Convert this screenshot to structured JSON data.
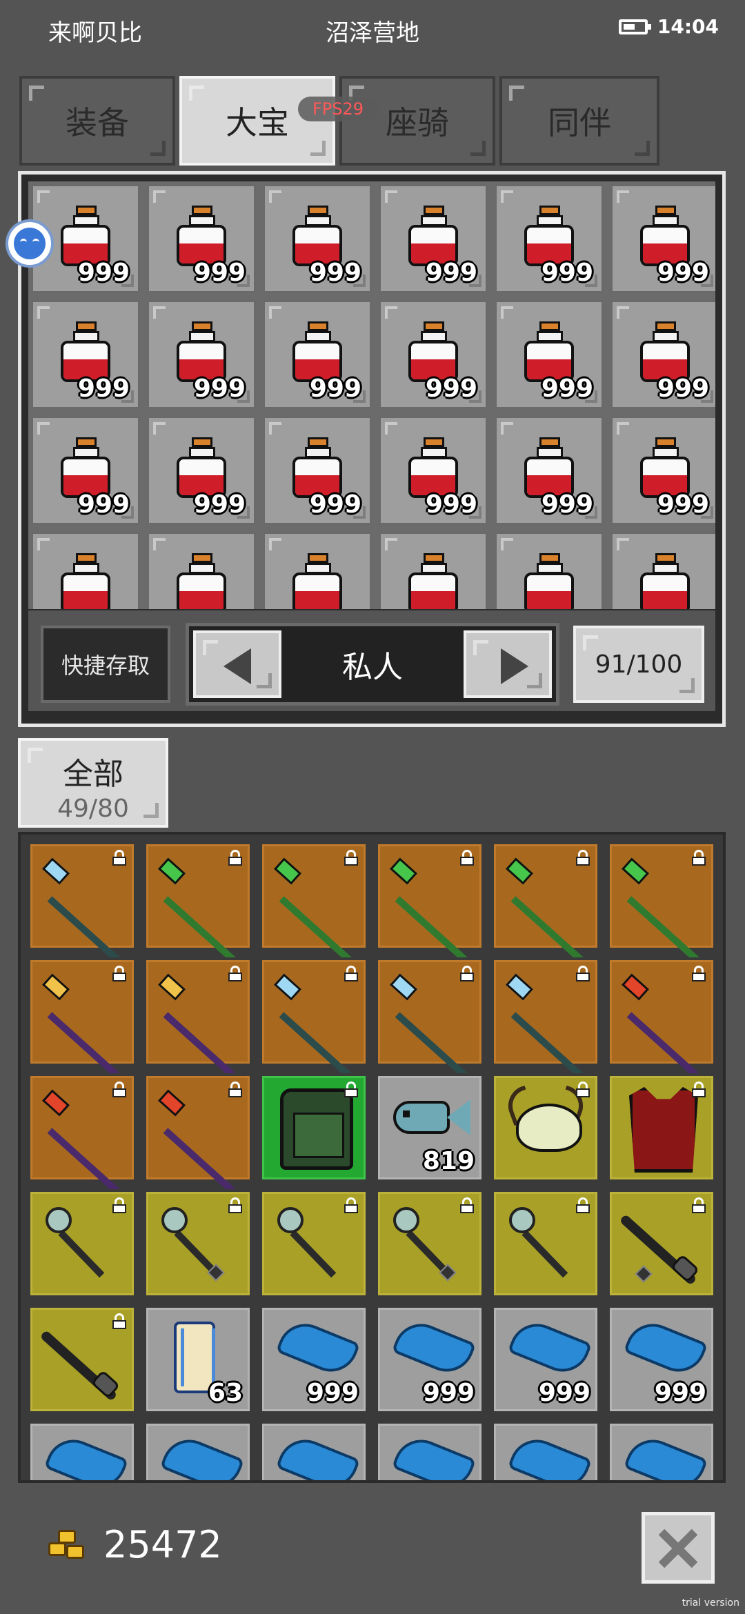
{
  "status_bar": {
    "left_text": "来啊贝比",
    "center_text": "沼泽营地",
    "time": "14:04"
  },
  "tabs": [
    {
      "label": "装备",
      "active": false
    },
    {
      "label": "大宝",
      "active": true
    },
    {
      "label": "座骑",
      "active": false
    },
    {
      "label": "同伴",
      "active": false
    }
  ],
  "fps_badge": "FPS29",
  "storage": {
    "slots": [
      {
        "item": "red-potion",
        "qty": "999"
      },
      {
        "item": "red-potion",
        "qty": "999"
      },
      {
        "item": "red-potion",
        "qty": "999"
      },
      {
        "item": "red-potion",
        "qty": "999"
      },
      {
        "item": "red-potion",
        "qty": "999"
      },
      {
        "item": "red-potion",
        "qty": "999"
      },
      {
        "item": "red-potion",
        "qty": "999"
      },
      {
        "item": "red-potion",
        "qty": "999"
      },
      {
        "item": "red-potion",
        "qty": "999"
      },
      {
        "item": "red-potion",
        "qty": "999"
      },
      {
        "item": "red-potion",
        "qty": "999"
      },
      {
        "item": "red-potion",
        "qty": "999"
      },
      {
        "item": "red-potion",
        "qty": "999"
      },
      {
        "item": "red-potion",
        "qty": "999"
      },
      {
        "item": "red-potion",
        "qty": "999"
      },
      {
        "item": "red-potion",
        "qty": "999"
      },
      {
        "item": "red-potion",
        "qty": "999"
      },
      {
        "item": "red-potion",
        "qty": "999"
      },
      {
        "item": "red-potion",
        "qty": ""
      },
      {
        "item": "red-potion",
        "qty": ""
      },
      {
        "item": "red-potion",
        "qty": ""
      },
      {
        "item": "red-potion",
        "qty": ""
      },
      {
        "item": "red-potion",
        "qty": ""
      },
      {
        "item": "red-potion",
        "qty": ""
      }
    ],
    "quick_access_label": "快捷存取",
    "page_label": "私人",
    "capacity": "91/100"
  },
  "bag": {
    "category_label": "全部",
    "category_count": "49/80",
    "slots": [
      {
        "item": "ice-staff",
        "bg": "brown",
        "locked": true,
        "qty": ""
      },
      {
        "item": "green-staff",
        "bg": "brown",
        "locked": true,
        "qty": ""
      },
      {
        "item": "green-staff",
        "bg": "brown",
        "locked": true,
        "qty": ""
      },
      {
        "item": "green-staff",
        "bg": "brown",
        "locked": true,
        "qty": ""
      },
      {
        "item": "green-staff",
        "bg": "brown",
        "locked": true,
        "qty": ""
      },
      {
        "item": "green-staff",
        "bg": "brown",
        "locked": true,
        "qty": ""
      },
      {
        "item": "gold-staff",
        "bg": "brown",
        "locked": true,
        "qty": ""
      },
      {
        "item": "gold-staff",
        "bg": "brown",
        "locked": true,
        "qty": ""
      },
      {
        "item": "ice-staff",
        "bg": "brown",
        "locked": true,
        "qty": ""
      },
      {
        "item": "ice-staff",
        "bg": "brown",
        "locked": true,
        "qty": ""
      },
      {
        "item": "ice-staff",
        "bg": "brown",
        "locked": true,
        "qty": ""
      },
      {
        "item": "fire-staff",
        "bg": "brown",
        "locked": true,
        "qty": ""
      },
      {
        "item": "fire-staff",
        "bg": "brown",
        "locked": true,
        "qty": ""
      },
      {
        "item": "fire-staff",
        "bg": "brown",
        "locked": true,
        "qty": ""
      },
      {
        "item": "backpack",
        "bg": "green",
        "locked": true,
        "qty": ""
      },
      {
        "item": "fish",
        "bg": "gray",
        "locked": false,
        "qty": "819"
      },
      {
        "item": "horned-helmet",
        "bg": "olive",
        "locked": true,
        "qty": ""
      },
      {
        "item": "red-armor",
        "bg": "olive",
        "locked": true,
        "qty": ""
      },
      {
        "item": "orb-wand",
        "bg": "olive",
        "locked": true,
        "qty": ""
      },
      {
        "item": "orb-wand-gem",
        "bg": "olive",
        "locked": true,
        "qty": ""
      },
      {
        "item": "orb-wand",
        "bg": "olive",
        "locked": true,
        "qty": ""
      },
      {
        "item": "orb-wand-gem",
        "bg": "olive",
        "locked": true,
        "qty": ""
      },
      {
        "item": "orb-wand",
        "bg": "olive",
        "locked": true,
        "qty": ""
      },
      {
        "item": "dark-club-gem",
        "bg": "olive",
        "locked": true,
        "qty": ""
      },
      {
        "item": "dark-club",
        "bg": "olive",
        "locked": true,
        "qty": ""
      },
      {
        "item": "scroll",
        "bg": "gray",
        "locked": false,
        "qty": "63"
      },
      {
        "item": "blue-feather",
        "bg": "gray",
        "locked": false,
        "qty": "999"
      },
      {
        "item": "blue-feather",
        "bg": "gray",
        "locked": false,
        "qty": "999"
      },
      {
        "item": "blue-feather",
        "bg": "gray",
        "locked": false,
        "qty": "999"
      },
      {
        "item": "blue-feather",
        "bg": "gray",
        "locked": false,
        "qty": "999"
      },
      {
        "item": "blue-feather",
        "bg": "gray",
        "locked": false,
        "qty": ""
      },
      {
        "item": "blue-feather",
        "bg": "gray",
        "locked": false,
        "qty": ""
      },
      {
        "item": "blue-feather",
        "bg": "gray",
        "locked": false,
        "qty": ""
      },
      {
        "item": "blue-feather",
        "bg": "gray",
        "locked": false,
        "qty": ""
      },
      {
        "item": "blue-feather",
        "bg": "gray",
        "locked": false,
        "qty": ""
      },
      {
        "item": "blue-feather",
        "bg": "gray",
        "locked": false,
        "qty": ""
      }
    ]
  },
  "gold": "25472",
  "watermark": "trial version",
  "colors": {
    "background": "#545454",
    "slot_brown": "#a8691f",
    "slot_olive": "#a9a028",
    "slot_green": "#23a832",
    "slot_gray": "#9e9e9e",
    "fps_text": "#ff5858"
  }
}
